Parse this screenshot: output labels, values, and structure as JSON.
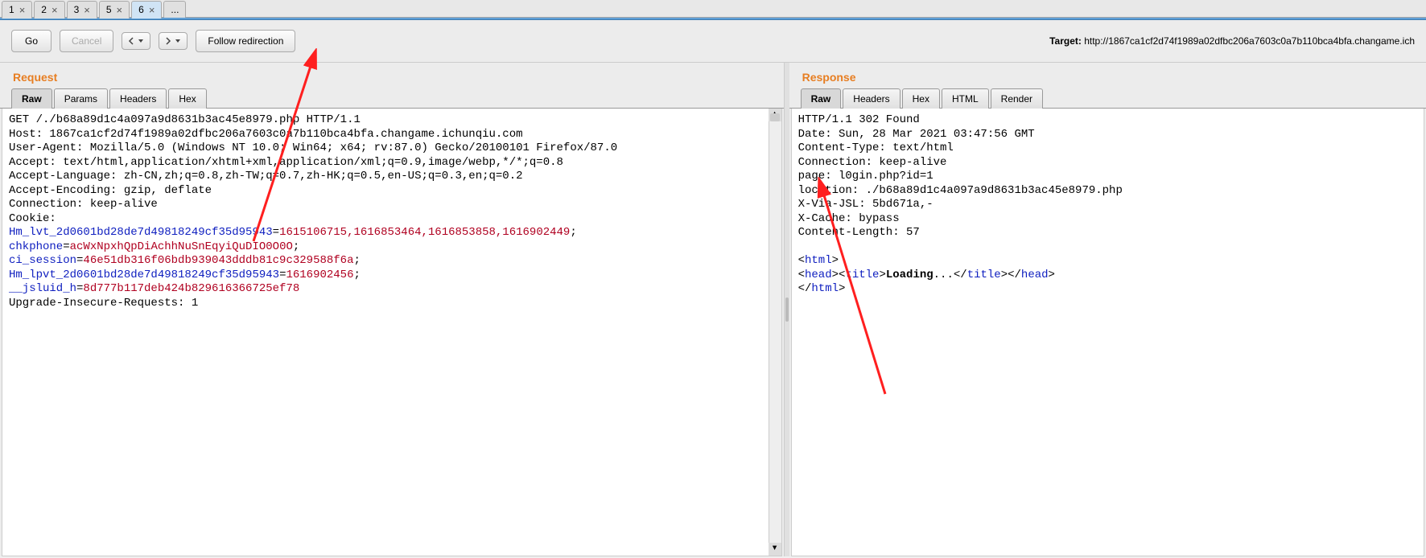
{
  "tabs": [
    "1",
    "2",
    "3",
    "5",
    "6",
    "..."
  ],
  "active_tab_index": 4,
  "toolbar": {
    "go": "Go",
    "cancel": "Cancel",
    "follow": "Follow redirection"
  },
  "target_label": "Target: ",
  "target_url": "http://1867ca1cf2d74f1989a02dfbc206a7603c0a7b110bca4bfa.changame.ich",
  "request": {
    "title": "Request",
    "tabs": [
      "Raw",
      "Params",
      "Headers",
      "Hex"
    ],
    "active_tab": 0,
    "lines": [
      {
        "t": "plain",
        "v": "GET /./b68a89d1c4a097a9d8631b3ac45e8979.php HTTP/1.1"
      },
      {
        "t": "plain",
        "v": "Host: 1867ca1cf2d74f1989a02dfbc206a7603c0a7b110bca4bfa.changame.ichunqiu.com"
      },
      {
        "t": "plain",
        "v": "User-Agent: Mozilla/5.0 (Windows NT 10.0; Win64; x64; rv:87.0) Gecko/20100101 Firefox/87.0"
      },
      {
        "t": "plain",
        "v": "Accept: text/html,application/xhtml+xml,application/xml;q=0.9,image/webp,*/*;q=0.8"
      },
      {
        "t": "plain",
        "v": "Accept-Language: zh-CN,zh;q=0.8,zh-TW;q=0.7,zh-HK;q=0.5,en-US;q=0.3,en;q=0.2"
      },
      {
        "t": "plain",
        "v": "Accept-Encoding: gzip, deflate"
      },
      {
        "t": "plain",
        "v": "Connection: keep-alive"
      },
      {
        "t": "plain",
        "v": "Cookie: "
      },
      {
        "t": "cookie",
        "pairs": [
          {
            "n": "Hm_lvt_2d0601bd28de7d49818249cf35d95943",
            "v": "1615106715,1616853464,1616853858,1616902449",
            "sep": "; "
          },
          {
            "n": "chkphone",
            "v": "acWxNpxhQpDiAchhNuSnEqyiQuDIO0O0O",
            "sep": "; "
          },
          {
            "n": "ci_session",
            "v": "46e51db316f06bdb939043dddb81c9c329588f6a",
            "sep": "; "
          },
          {
            "n": "Hm_lpvt_2d0601bd28de7d49818249cf35d95943",
            "v": "1616902456",
            "sep": "; "
          },
          {
            "n": "__jsluid_h",
            "v": "8d777b117deb424b829616366725ef78",
            "sep": ""
          }
        ]
      },
      {
        "t": "plain",
        "v": "Upgrade-Insecure-Requests: 1"
      }
    ]
  },
  "response": {
    "title": "Response",
    "tabs": [
      "Raw",
      "Headers",
      "Hex",
      "HTML",
      "Render"
    ],
    "active_tab": 0,
    "headers": [
      "HTTP/1.1 302 Found",
      "Date: Sun, 28 Mar 2021 03:47:56 GMT",
      "Content-Type: text/html",
      "Connection: keep-alive",
      "page: l0gin.php?id=1",
      "location: ./b68a89d1c4a097a9d8631b3ac45e8979.php",
      "X-Via-JSL: 5bd671a,-",
      "X-Cache: bypass",
      "Content-Length: 57"
    ],
    "body_html": {
      "open_html": "html",
      "open_head": "head",
      "open_title": "title",
      "title_text": "Loading",
      "title_dots": "...",
      "close_title": "title",
      "close_head": "head",
      "close_html": "html"
    }
  }
}
